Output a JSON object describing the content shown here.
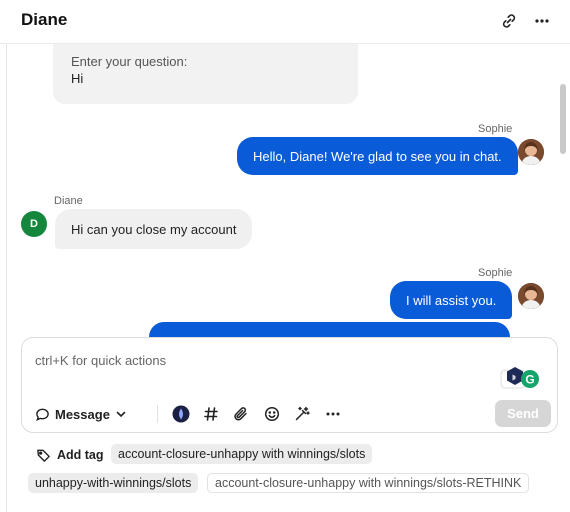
{
  "header": {
    "title": "Diane"
  },
  "form": {
    "question_label": "Enter your question:",
    "answer": "Hi"
  },
  "messages": [
    {
      "sender": "Sophie",
      "text": "Hello, Diane! We're glad to see you in chat.",
      "direction": "outgoing"
    },
    {
      "sender": "Diane",
      "text": "Hi can you close my account",
      "direction": "incoming",
      "avatar_initial": "D"
    },
    {
      "sender": "Sophie",
      "text": "I will assist you.",
      "direction": "outgoing"
    }
  ],
  "composer": {
    "placeholder": "ctrl+K for quick actions",
    "mode_label": "Message",
    "send_label": "Send",
    "grammar_badge_letter": "G"
  },
  "tags": {
    "add_label": "Add tag",
    "items": [
      "account-closure-unhappy with winnings/slots",
      "unhappy-with-winnings/slots",
      "account-closure-unhappy with winnings/slots-RETHINK"
    ]
  },
  "colors": {
    "outgoing_bubble": "#0a5bd7",
    "incoming_bubble": "#f0f0f0",
    "customer_avatar": "#14873c",
    "send_disabled": "#d6d6d6"
  }
}
